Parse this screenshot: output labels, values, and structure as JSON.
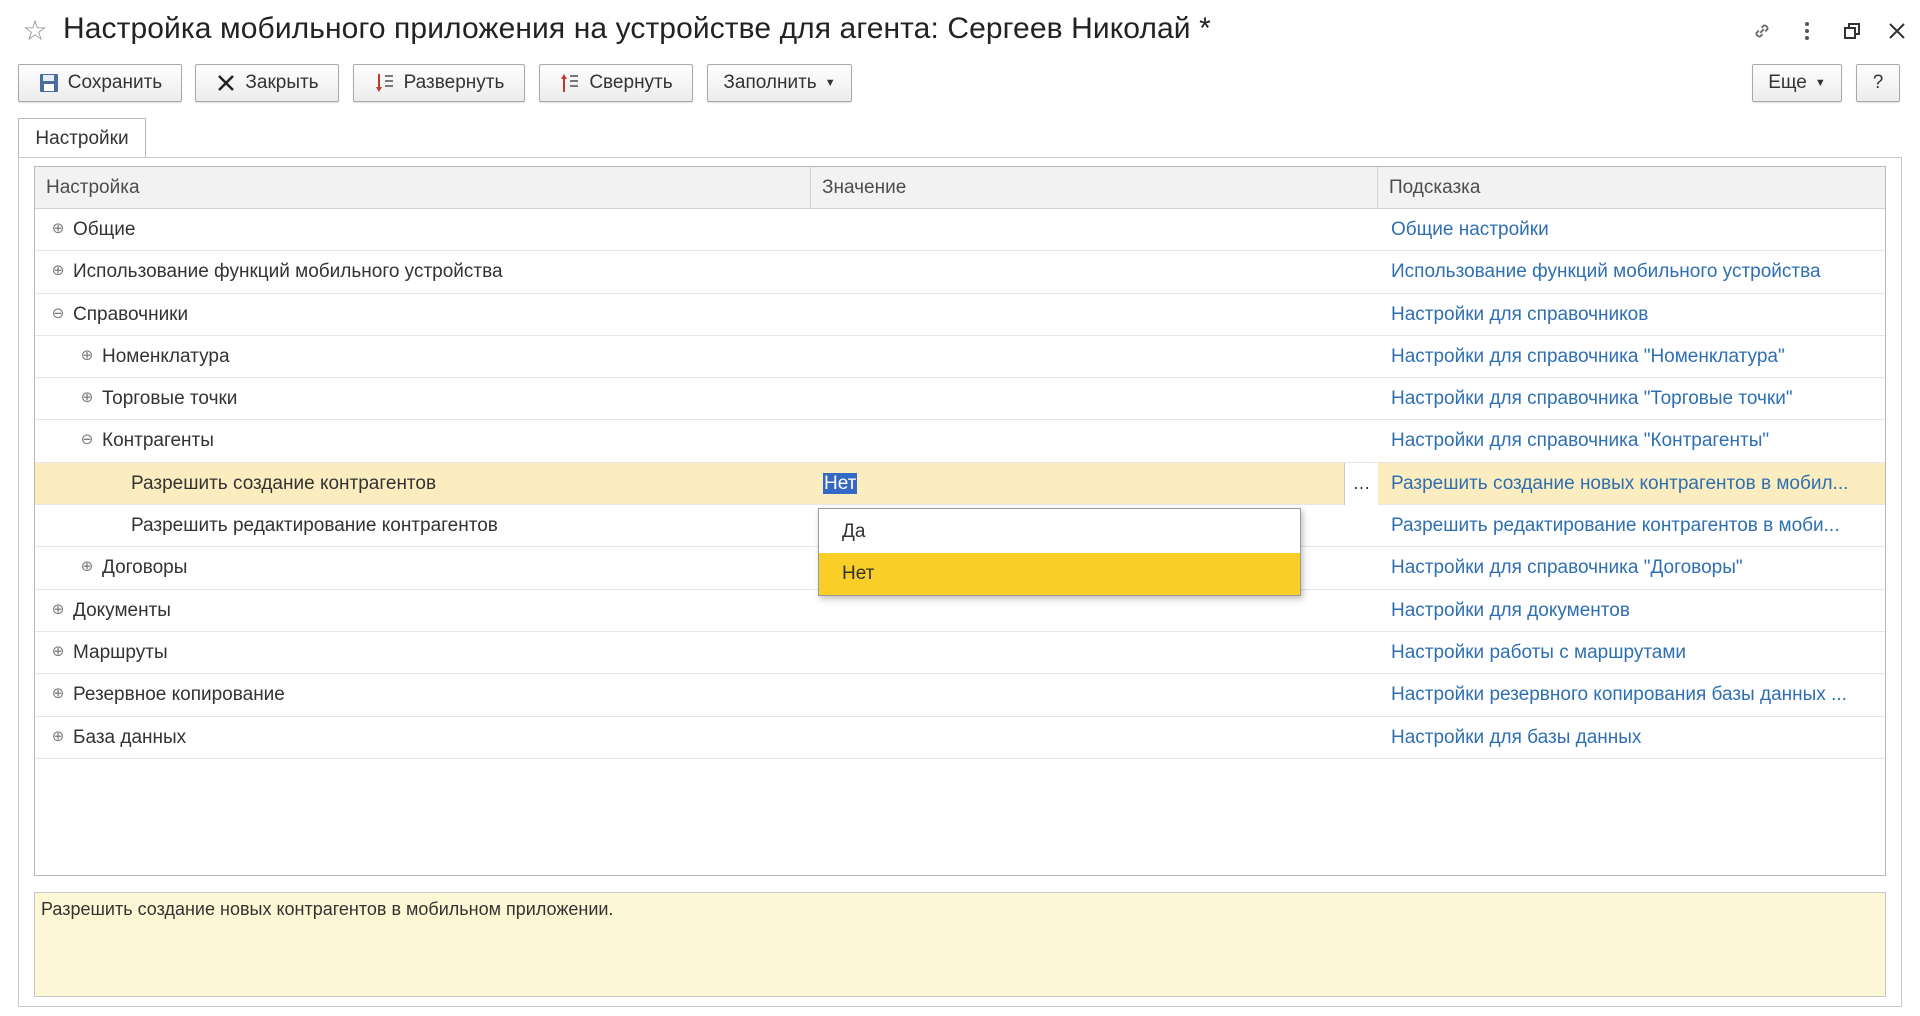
{
  "window": {
    "title": "Настройка мобильного приложения на устройстве для агента: Сергеев Николай *",
    "icons": {
      "favorite": "star-icon",
      "link": "link-icon",
      "more": "vertical-dots-icon",
      "restore": "restore-window-icon",
      "close": "close-icon"
    }
  },
  "toolbar": {
    "save_label": "Сохранить",
    "close_label": "Закрыть",
    "expand_label": "Развернуть",
    "collapse_label": "Свернуть",
    "fill_label": "Заполнить",
    "more_label": "Еще",
    "help_label": "?"
  },
  "tabs": [
    {
      "label": "Настройки"
    }
  ],
  "grid": {
    "columns": [
      {
        "label": "Настройка"
      },
      {
        "label": "Значение"
      },
      {
        "label": "Подсказка"
      }
    ],
    "rows": [
      {
        "setting": "Общие",
        "level": 0,
        "expander": "plus",
        "value": "",
        "hint": "Общие настройки"
      },
      {
        "setting": "Использование функций мобильного устройства",
        "level": 0,
        "expander": "plus",
        "value": "",
        "hint": "Использование функций мобильного устройства"
      },
      {
        "setting": "Справочники",
        "level": 0,
        "expander": "minus",
        "value": "",
        "hint": "Настройки для справочников"
      },
      {
        "setting": "Номенклатура",
        "level": 1,
        "expander": "plus",
        "value": "",
        "hint": "Настройки для справочника \"Номенклатура\""
      },
      {
        "setting": "Торговые точки",
        "level": 1,
        "expander": "plus",
        "value": "",
        "hint": "Настройки для справочника \"Торговые точки\""
      },
      {
        "setting": "Контрагенты",
        "level": 1,
        "expander": "minus",
        "value": "",
        "hint": "Настройки для справочника \"Контрагенты\""
      },
      {
        "setting": "Разрешить создание контрагентов",
        "level": 2,
        "expander": "none",
        "value": "Нет",
        "selected": true,
        "hint": "Разрешить создание новых контрагентов в мобил..."
      },
      {
        "setting": "Разрешить редактирование контрагентов",
        "level": 2,
        "expander": "none",
        "value": "",
        "hint": "Разрешить редактирование контрагентов в моби..."
      },
      {
        "setting": "Договоры",
        "level": 1,
        "expander": "plus",
        "value": "",
        "hint": "Настройки для справочника \"Договоры\""
      },
      {
        "setting": "Документы",
        "level": 0,
        "expander": "plus",
        "value": "",
        "hint": "Настройки для документов"
      },
      {
        "setting": "Маршруты",
        "level": 0,
        "expander": "plus",
        "value": "",
        "hint": "Настройки работы с маршрутами"
      },
      {
        "setting": "Резервное копирование",
        "level": 0,
        "expander": "plus",
        "value": "",
        "hint": "Настройки резервного копирования базы данных ..."
      },
      {
        "setting": "База данных",
        "level": 0,
        "expander": "plus",
        "value": "",
        "hint": "Настройки для базы данных"
      }
    ]
  },
  "dropdown": {
    "options": [
      {
        "label": "Да",
        "active": false
      },
      {
        "label": "Нет",
        "active": true
      }
    ]
  },
  "hint_panel": {
    "text": "Разрешить создание новых контрагентов в мобильном приложении."
  },
  "colors": {
    "selected_row": "#fbedc0",
    "dropdown_active": "#f9ce27",
    "hint_link": "#2e6fb3",
    "hint_panel_bg": "#fdf7d5",
    "text_selection": "#3468c4"
  }
}
